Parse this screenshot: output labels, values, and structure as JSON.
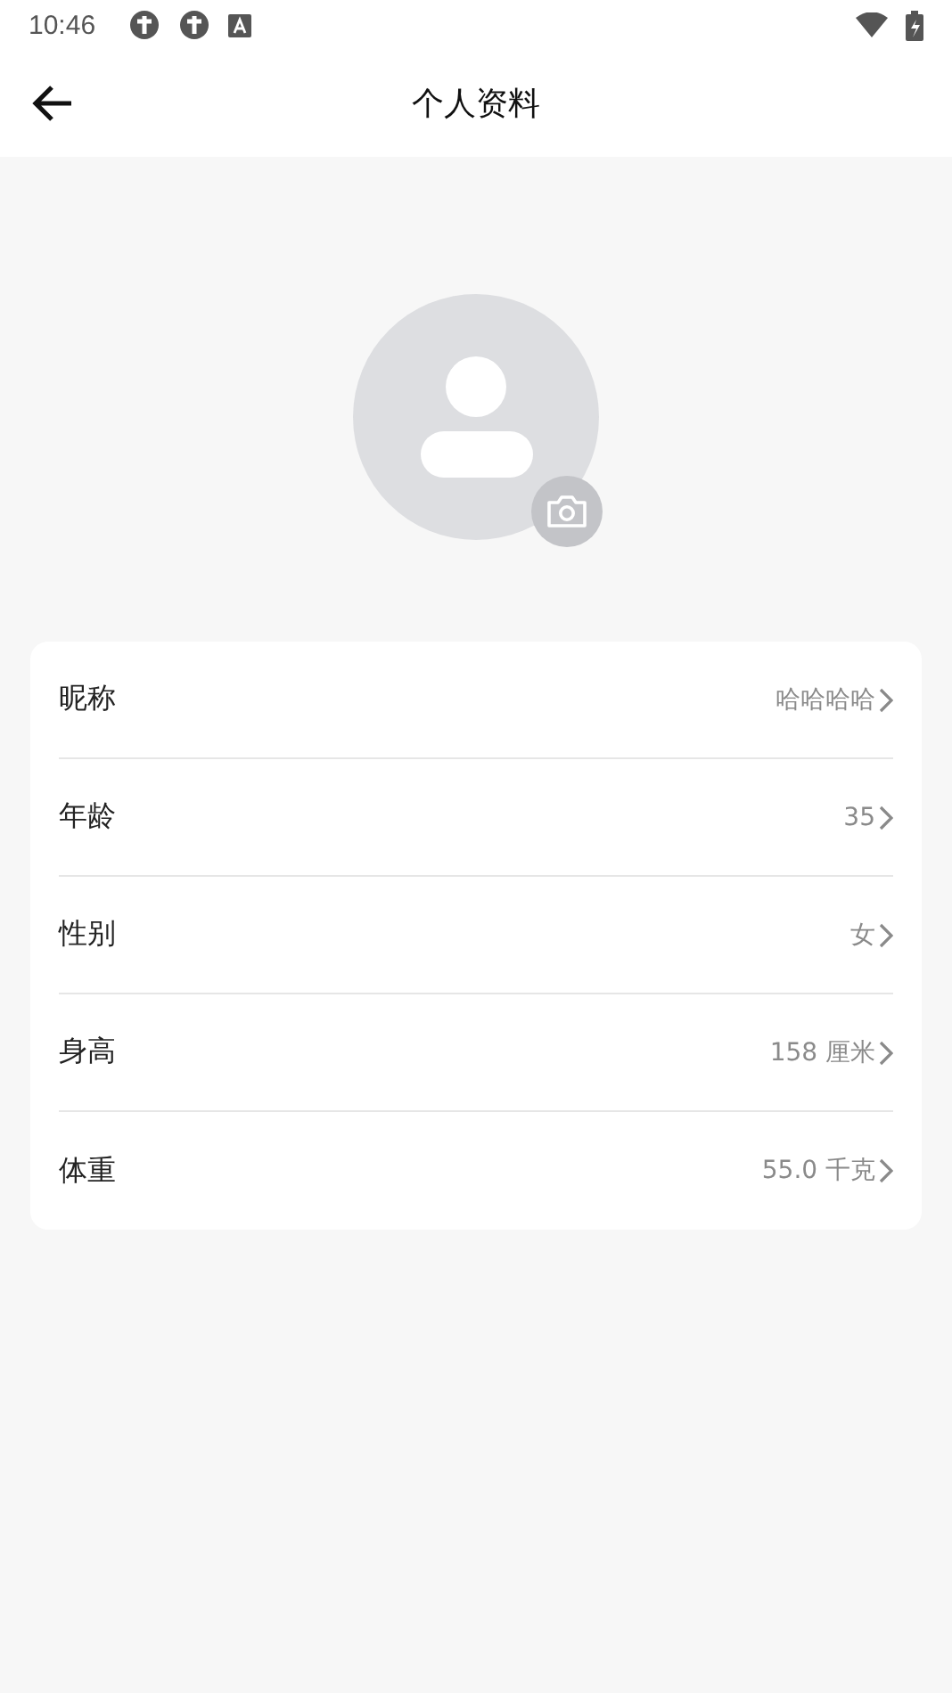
{
  "status_bar": {
    "time": "10:46"
  },
  "header": {
    "title": "个人资料"
  },
  "fields": [
    {
      "label": "昵称",
      "value": "哈哈哈哈"
    },
    {
      "label": "年龄",
      "value": "35"
    },
    {
      "label": "性别",
      "value": "女"
    },
    {
      "label": "身高",
      "value": "158 厘米"
    },
    {
      "label": "体重",
      "value": "55.0 千克"
    }
  ]
}
